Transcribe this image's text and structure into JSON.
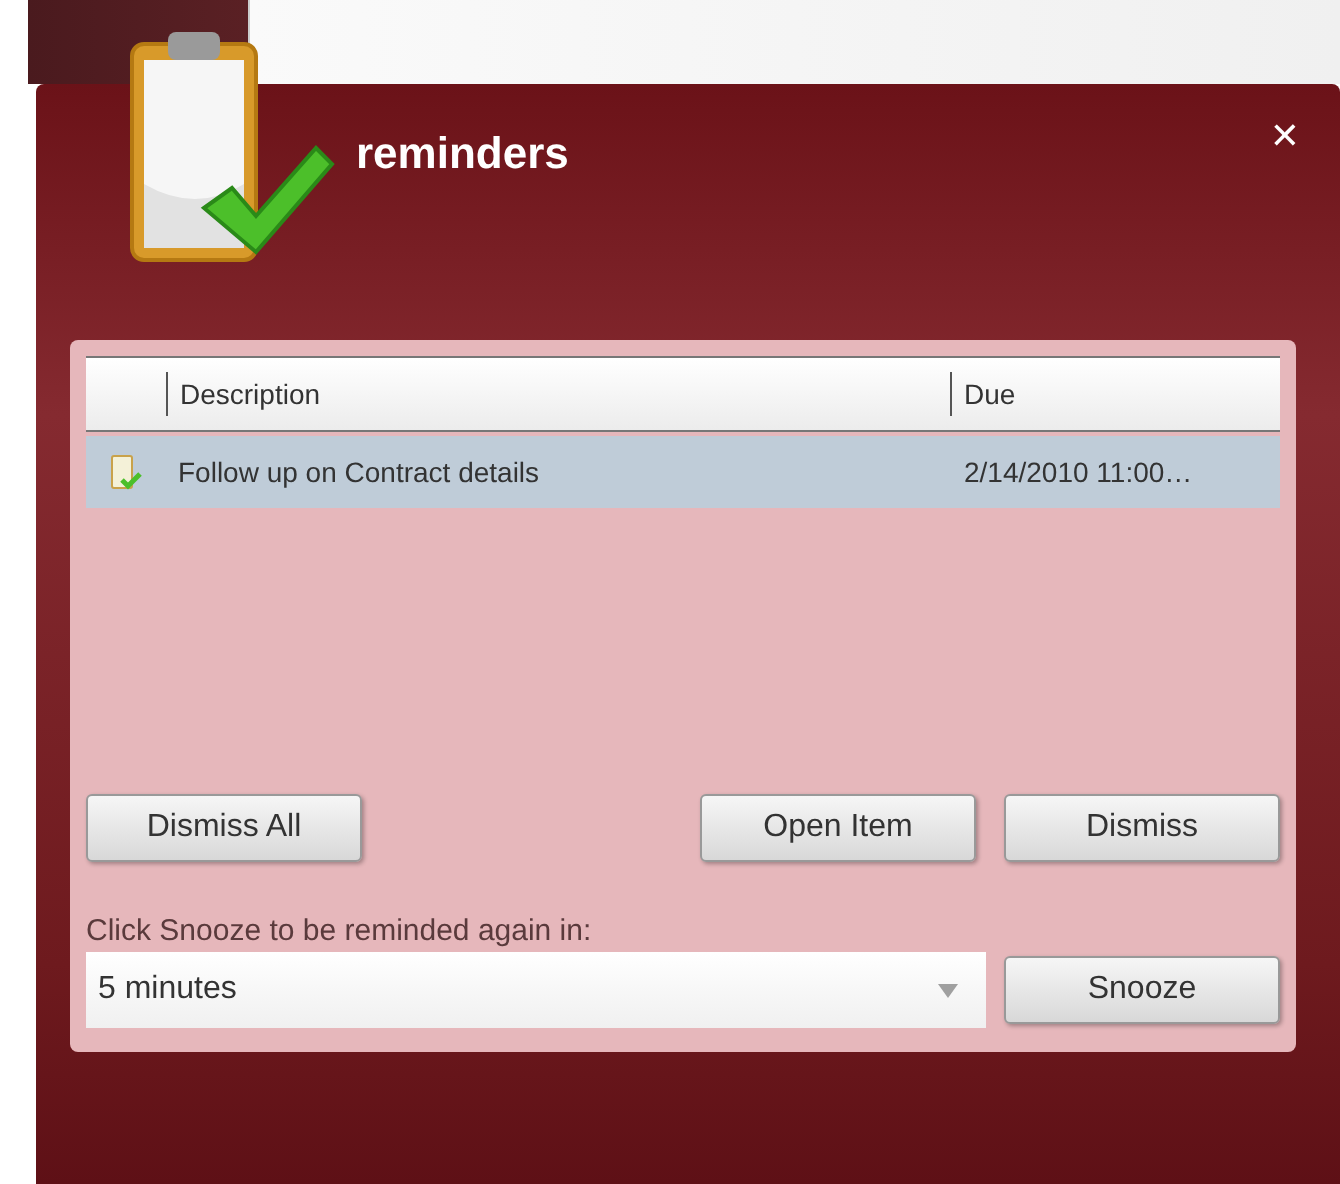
{
  "window": {
    "title": "reminders",
    "close": "✕"
  },
  "table": {
    "columns": [
      "Description",
      "Due"
    ],
    "rows": [
      {
        "description": "Follow up on Contract details",
        "due": "2/14/2010 11:00…",
        "selected": true
      }
    ]
  },
  "buttons_left": [
    "Dismiss All"
  ],
  "buttons_right": [
    "Open Item",
    "Dismiss"
  ],
  "snooze": {
    "label": "Click Snooze to be reminded again in:",
    "value": "5 minutes",
    "button": "Snooze"
  }
}
